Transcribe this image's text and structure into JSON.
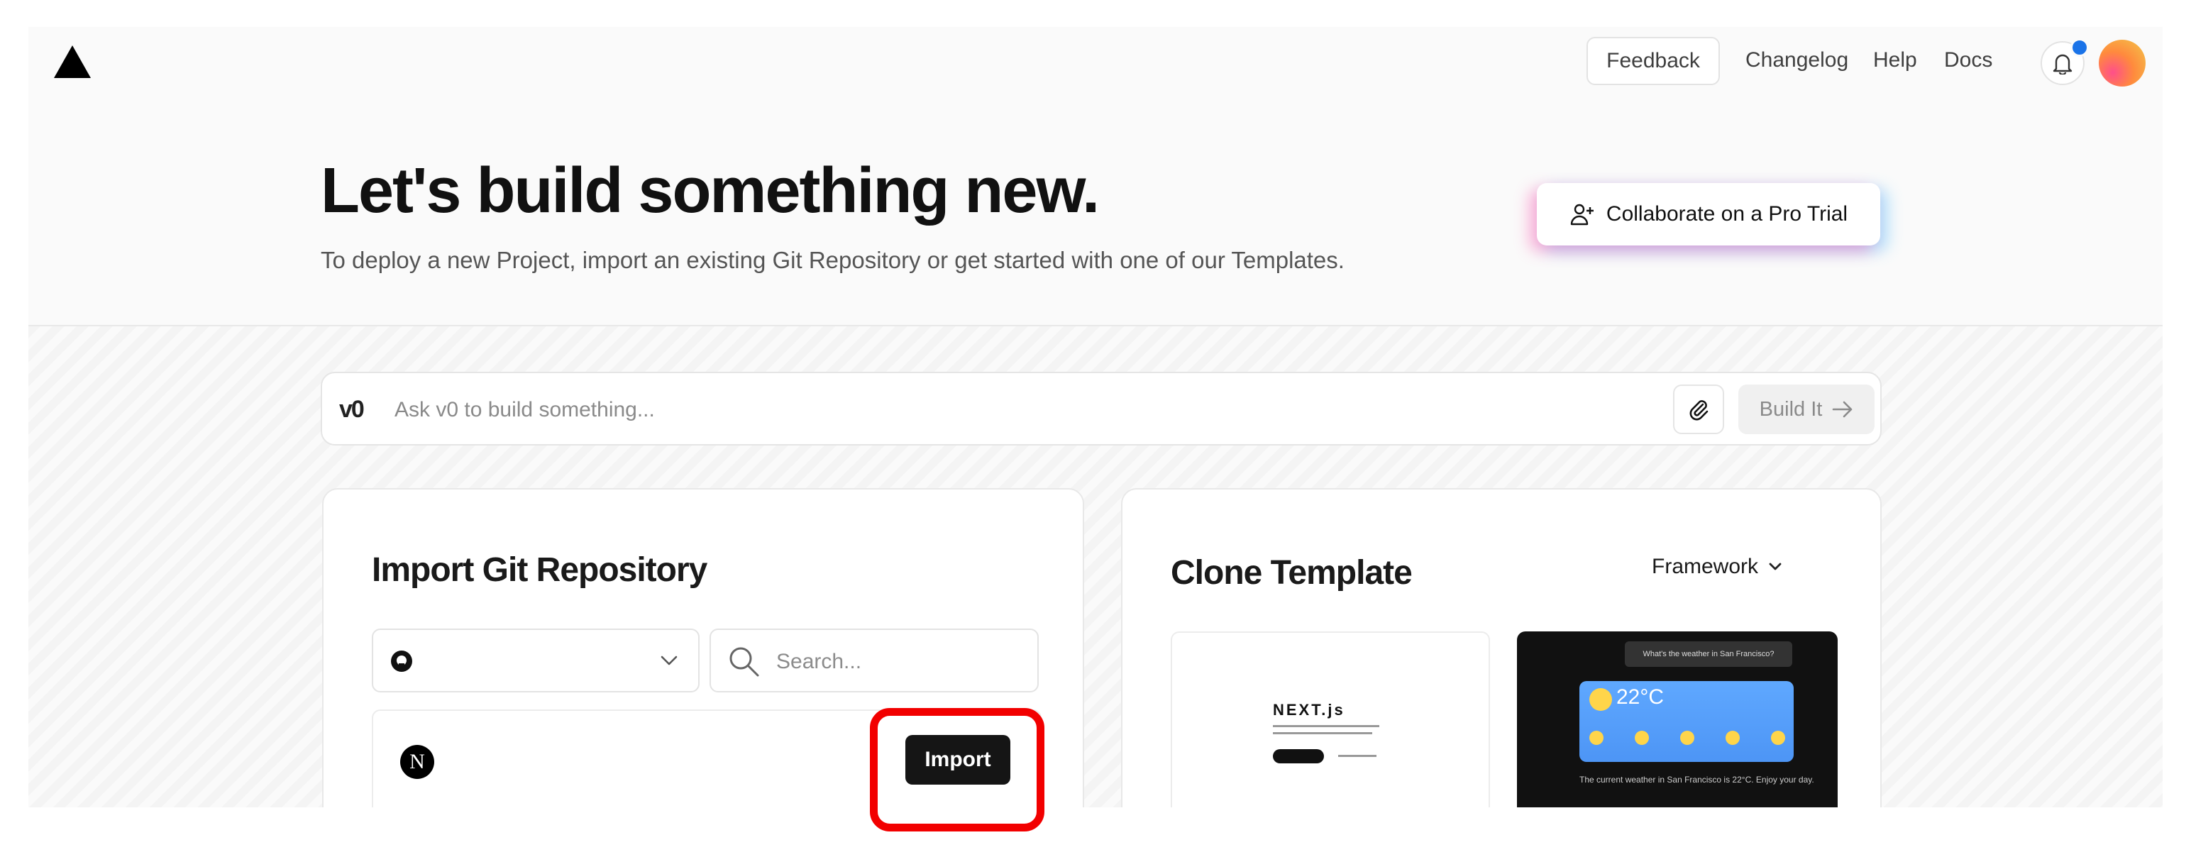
{
  "nav": {
    "feedback": "Feedback",
    "changelog": "Changelog",
    "help": "Help",
    "docs": "Docs",
    "notification_indicator_color": "#1a73e8"
  },
  "hero": {
    "title": "Let's build something new.",
    "subtitle": "To deploy a new Project, import an existing Git Repository or get started with one of our Templates.",
    "pro_trial_button": "Collaborate on a Pro Trial"
  },
  "ask": {
    "placeholder": "Ask v0 to build something...",
    "build_button": "Build It"
  },
  "import": {
    "title": "Import Git Repository",
    "provider_icon": "github-icon",
    "search_placeholder": "Search...",
    "repo_icon": "nextjs-icon",
    "repo_icon_letter": "N",
    "import_button": "Import"
  },
  "clone": {
    "title": "Clone Template",
    "framework_label": "Framework",
    "templates": [
      {
        "logo_text": "NEXT.js"
      },
      {
        "prompt": "What's the weather in San Francisco?",
        "temperature": "22°C",
        "note": "The current weather in San Francisco is 22°C. Enjoy your day."
      }
    ]
  },
  "colors": {
    "highlight": "#f20000",
    "primary_button": "#151515"
  }
}
